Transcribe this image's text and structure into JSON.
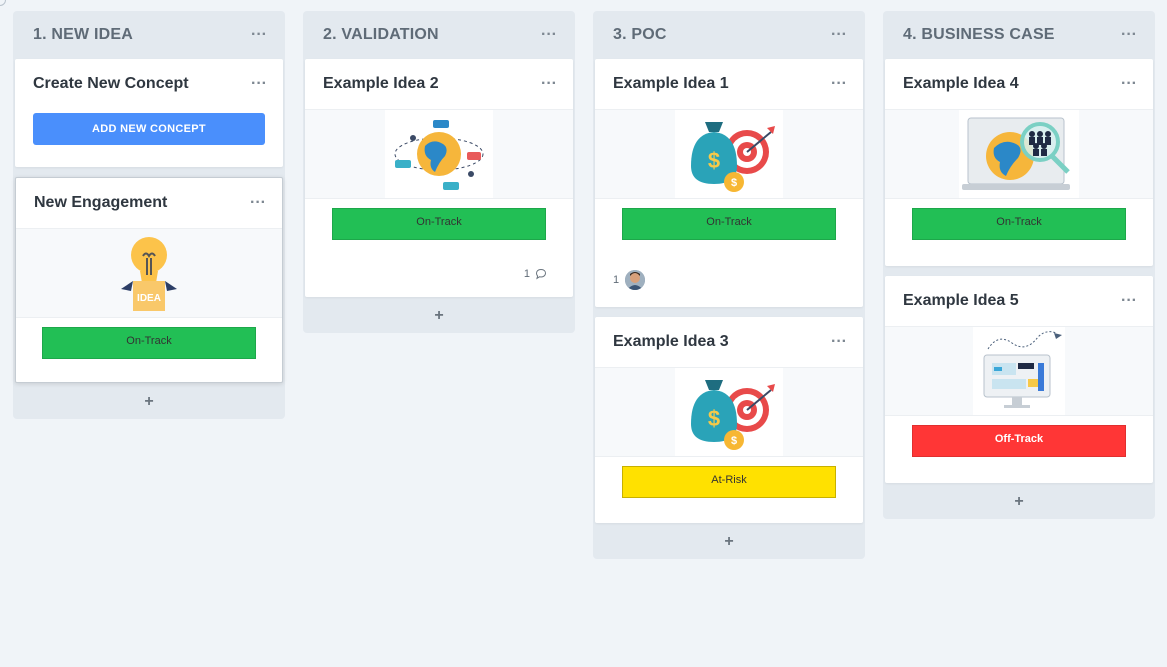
{
  "lanes": [
    {
      "title": "1. NEW IDEA",
      "menu": "···",
      "add": "+",
      "create_card": {
        "title": "Create New Concept",
        "menu": "···",
        "button": "ADD NEW CONCEPT"
      },
      "cards": [
        {
          "title": "New Engagement",
          "menu": "···",
          "image": "idea-box-icon",
          "status": "On-Track",
          "status_color": "#22bf55"
        }
      ]
    },
    {
      "title": "2. VALIDATION",
      "menu": "···",
      "add": "+",
      "cards": [
        {
          "title": "Example Idea 2",
          "menu": "···",
          "image": "globe-network-icon",
          "status": "On-Track",
          "status_color": "#22bf55",
          "comments": "1"
        }
      ]
    },
    {
      "title": "3. POC",
      "menu": "···",
      "add": "+",
      "cards": [
        {
          "title": "Example Idea 1",
          "menu": "···",
          "image": "money-bag-target-icon",
          "status": "On-Track",
          "status_color": "#22bf55",
          "assignees": "1"
        },
        {
          "title": "Example Idea 3",
          "menu": "···",
          "image": "money-bag-target-icon",
          "status": "At-Risk",
          "status_color": "#ffe100"
        }
      ]
    },
    {
      "title": "4. BUSINESS CASE",
      "menu": "···",
      "add": "+",
      "cards": [
        {
          "title": "Example Idea 4",
          "menu": "···",
          "image": "laptop-globe-search-icon",
          "status": "On-Track",
          "status_color": "#22bf55"
        },
        {
          "title": "Example Idea 5",
          "menu": "···",
          "image": "monitor-chart-icon",
          "status": "Off-Track",
          "status_color": "#ff3636"
        }
      ]
    }
  ]
}
